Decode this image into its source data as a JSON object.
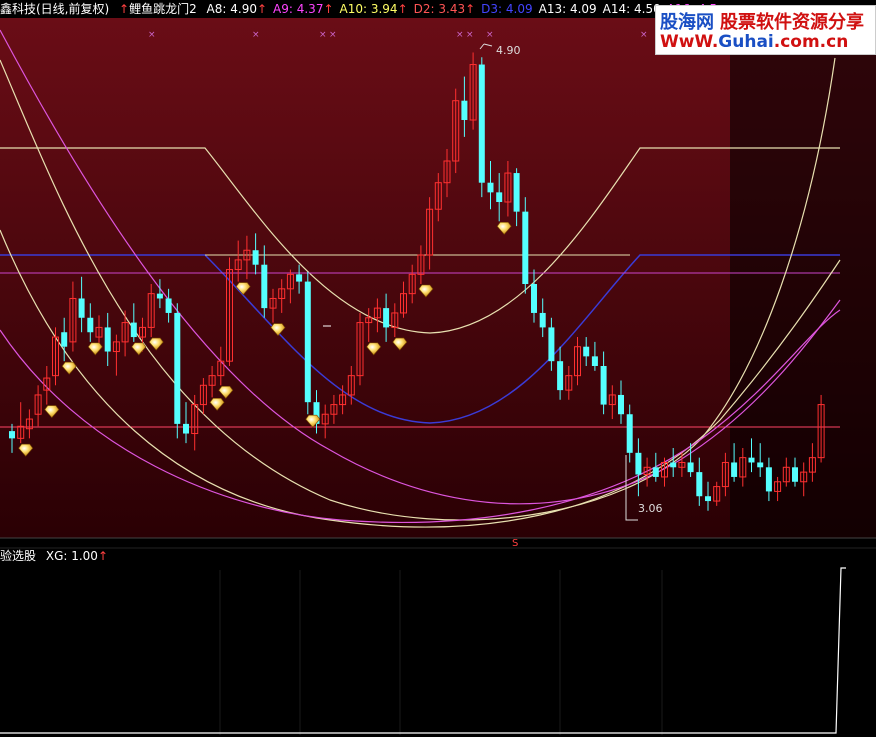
{
  "header": {
    "stock_title": "鑫科技(日线,前复权)",
    "indicator_name": "鲤鱼跳龙门2",
    "values": [
      {
        "label": "A8: 4.90",
        "color": "#ffffff",
        "arrow": true
      },
      {
        "label": "A9: 4.37",
        "color": "#ff44ff",
        "arrow": true
      },
      {
        "label": "A10: 3.94",
        "color": "#ffff66",
        "arrow": true
      },
      {
        "label": "D2: 3.43",
        "color": "#ff5555",
        "arrow": true
      },
      {
        "label": "D3: 4.09",
        "color": "#4444ff",
        "arrow": false
      },
      {
        "label": "A13: 4.09",
        "color": "#ffffff",
        "arrow": false
      },
      {
        "label": "A14: 4.50",
        "color": "#ffffff",
        "arrow": false
      },
      {
        "label": "A16: 4.5",
        "color": "#ff44ff",
        "arrow": false
      }
    ]
  },
  "price_labels": {
    "high": "4.90",
    "low": "3.06"
  },
  "sub_header": {
    "name": "验选股",
    "value": "XG: 1.00"
  },
  "watermark": {
    "line1a": "股海网",
    "line1b": "股票软件资源分享",
    "line2a": "WwW.",
    "line2b": "Guhai",
    "line2c": ".com.cn"
  },
  "colors": {
    "up": "#ff3030",
    "down": "#55ffff",
    "bg_top": "#6a0d16",
    "bg_bottom": "#2a0004"
  },
  "candles": [
    [
      3.33,
      3.36,
      3.24,
      3.3
    ],
    [
      3.3,
      3.45,
      3.28,
      3.35
    ],
    [
      3.34,
      3.42,
      3.3,
      3.38
    ],
    [
      3.4,
      3.52,
      3.35,
      3.48
    ],
    [
      3.5,
      3.6,
      3.44,
      3.55
    ],
    [
      3.56,
      3.76,
      3.52,
      3.72
    ],
    [
      3.74,
      3.8,
      3.62,
      3.68
    ],
    [
      3.7,
      3.95,
      3.66,
      3.88
    ],
    [
      3.88,
      3.97,
      3.74,
      3.8
    ],
    [
      3.8,
      3.86,
      3.7,
      3.74
    ],
    [
      3.72,
      3.81,
      3.68,
      3.76
    ],
    [
      3.76,
      3.82,
      3.6,
      3.66
    ],
    [
      3.66,
      3.73,
      3.56,
      3.7
    ],
    [
      3.7,
      3.83,
      3.64,
      3.78
    ],
    [
      3.78,
      3.86,
      3.7,
      3.72
    ],
    [
      3.72,
      3.8,
      3.66,
      3.76
    ],
    [
      3.76,
      3.94,
      3.72,
      3.9
    ],
    [
      3.9,
      3.96,
      3.84,
      3.88
    ],
    [
      3.88,
      3.92,
      3.78,
      3.82
    ],
    [
      3.82,
      3.86,
      3.3,
      3.36
    ],
    [
      3.36,
      3.45,
      3.28,
      3.32
    ],
    [
      3.32,
      3.48,
      3.25,
      3.44
    ],
    [
      3.44,
      3.55,
      3.4,
      3.52
    ],
    [
      3.52,
      3.6,
      3.47,
      3.56
    ],
    [
      3.56,
      3.68,
      3.52,
      3.62
    ],
    [
      3.62,
      4.05,
      3.6,
      4.0
    ],
    [
      4.0,
      4.12,
      3.95,
      4.04
    ],
    [
      4.04,
      4.14,
      3.96,
      4.08
    ],
    [
      4.08,
      4.15,
      3.98,
      4.02
    ],
    [
      4.02,
      4.1,
      3.8,
      3.84
    ],
    [
      3.84,
      3.92,
      3.78,
      3.88
    ],
    [
      3.88,
      3.96,
      3.82,
      3.92
    ],
    [
      3.92,
      4.0,
      3.86,
      3.98
    ],
    [
      3.98,
      4.02,
      3.9,
      3.95
    ],
    [
      3.95,
      3.99,
      3.4,
      3.45
    ],
    [
      3.45,
      3.5,
      3.32,
      3.36
    ],
    [
      3.36,
      3.44,
      3.3,
      3.4
    ],
    [
      3.4,
      3.48,
      3.36,
      3.44
    ],
    [
      3.44,
      3.52,
      3.4,
      3.48
    ],
    [
      3.48,
      3.6,
      3.44,
      3.56
    ],
    [
      3.56,
      3.82,
      3.52,
      3.78
    ],
    [
      3.78,
      3.84,
      3.7,
      3.8
    ],
    [
      3.8,
      3.88,
      3.74,
      3.84
    ],
    [
      3.84,
      3.9,
      3.7,
      3.76
    ],
    [
      3.76,
      3.86,
      3.72,
      3.82
    ],
    [
      3.82,
      3.95,
      3.8,
      3.9
    ],
    [
      3.9,
      4.02,
      3.86,
      3.98
    ],
    [
      3.98,
      4.1,
      3.94,
      4.06
    ],
    [
      4.06,
      4.3,
      4.0,
      4.25
    ],
    [
      4.25,
      4.4,
      4.2,
      4.36
    ],
    [
      4.36,
      4.5,
      4.3,
      4.45
    ],
    [
      4.45,
      4.75,
      4.4,
      4.7
    ],
    [
      4.7,
      4.8,
      4.55,
      4.62
    ],
    [
      4.62,
      4.9,
      4.58,
      4.85
    ],
    [
      4.85,
      4.88,
      4.3,
      4.36
    ],
    [
      4.36,
      4.45,
      4.25,
      4.32
    ],
    [
      4.32,
      4.4,
      4.2,
      4.28
    ],
    [
      4.28,
      4.45,
      4.22,
      4.4
    ],
    [
      4.4,
      4.42,
      4.18,
      4.24
    ],
    [
      4.24,
      4.3,
      3.9,
      3.94
    ],
    [
      3.94,
      4.0,
      3.78,
      3.82
    ],
    [
      3.82,
      3.88,
      3.72,
      3.76
    ],
    [
      3.76,
      3.8,
      3.58,
      3.62
    ],
    [
      3.62,
      3.68,
      3.46,
      3.5
    ],
    [
      3.5,
      3.6,
      3.46,
      3.56
    ],
    [
      3.56,
      3.72,
      3.52,
      3.68
    ],
    [
      3.68,
      3.72,
      3.6,
      3.64
    ],
    [
      3.64,
      3.7,
      3.58,
      3.6
    ],
    [
      3.6,
      3.66,
      3.4,
      3.44
    ],
    [
      3.44,
      3.52,
      3.38,
      3.48
    ],
    [
      3.48,
      3.54,
      3.36,
      3.4
    ],
    [
      3.4,
      3.44,
      3.2,
      3.24
    ],
    [
      3.24,
      3.3,
      3.06,
      3.15
    ],
    [
      3.15,
      3.22,
      3.1,
      3.18
    ],
    [
      3.18,
      3.24,
      3.12,
      3.14
    ],
    [
      3.14,
      3.22,
      3.1,
      3.2
    ],
    [
      3.2,
      3.26,
      3.14,
      3.18
    ],
    [
      3.18,
      3.24,
      3.14,
      3.2
    ],
    [
      3.2,
      3.28,
      3.14,
      3.16
    ],
    [
      3.16,
      3.22,
      3.02,
      3.06
    ],
    [
      3.06,
      3.12,
      3.0,
      3.04
    ],
    [
      3.04,
      3.12,
      3.02,
      3.1
    ],
    [
      3.1,
      3.24,
      3.06,
      3.2
    ],
    [
      3.2,
      3.28,
      3.12,
      3.14
    ],
    [
      3.14,
      3.26,
      3.1,
      3.22
    ],
    [
      3.22,
      3.3,
      3.16,
      3.2
    ],
    [
      3.2,
      3.28,
      3.14,
      3.18
    ],
    [
      3.18,
      3.22,
      3.04,
      3.08
    ],
    [
      3.08,
      3.14,
      3.04,
      3.12
    ],
    [
      3.12,
      3.22,
      3.1,
      3.18
    ],
    [
      3.18,
      3.22,
      3.1,
      3.12
    ],
    [
      3.12,
      3.2,
      3.06,
      3.16
    ],
    [
      3.16,
      3.28,
      3.12,
      3.22
    ],
    [
      3.22,
      3.48,
      3.2,
      3.44
    ]
  ],
  "signal_indices": [
    1,
    4,
    6,
    9,
    14,
    16,
    23,
    24,
    26,
    30,
    34,
    41,
    44,
    47,
    56
  ]
}
